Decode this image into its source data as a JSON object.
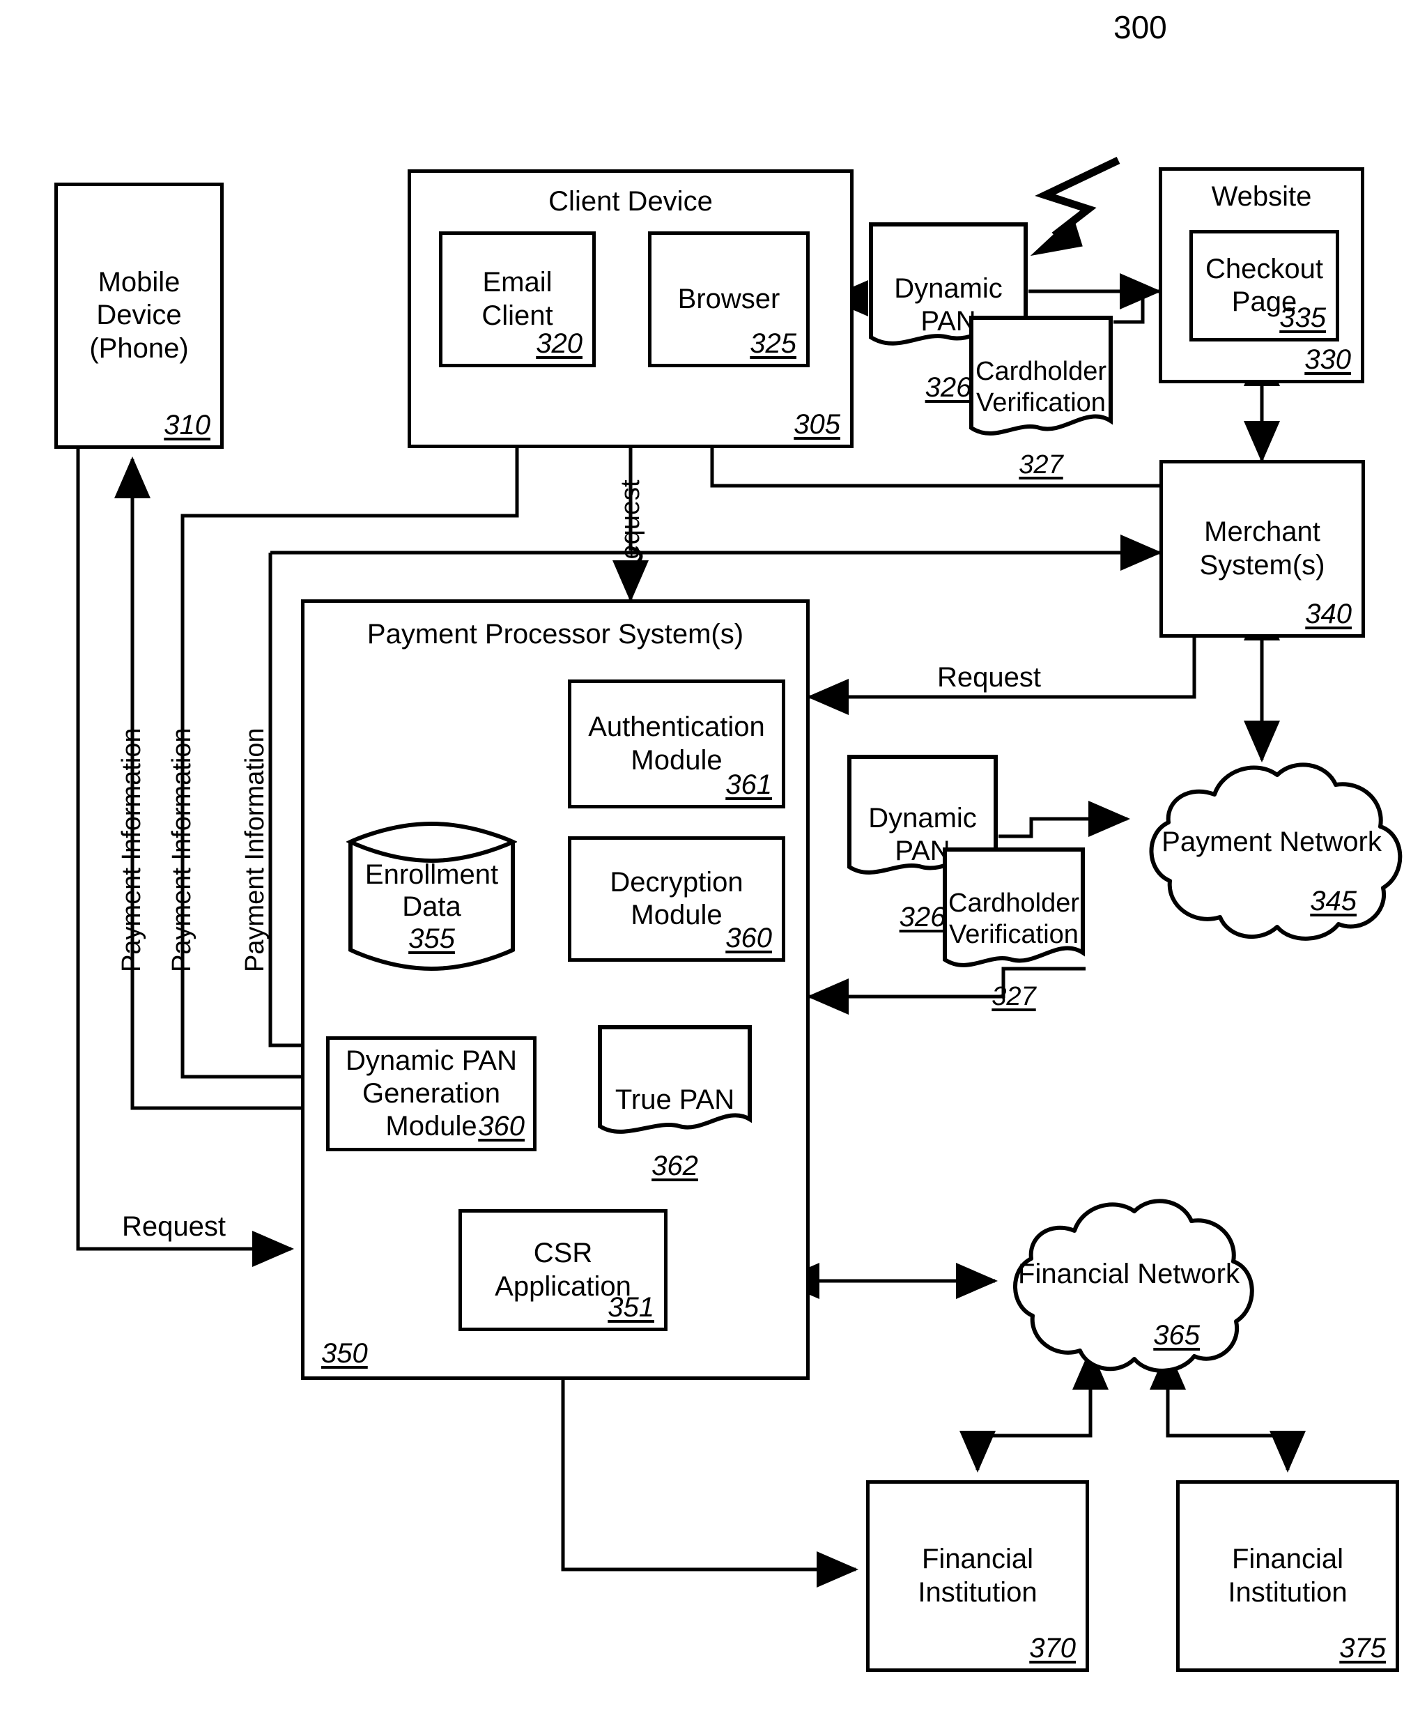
{
  "figure": {
    "number": "300",
    "pointer_icon": "lightning-bolt-pointer"
  },
  "nodes": {
    "mobile_device": {
      "label": "Mobile\nDevice\n(Phone)",
      "ref": "310"
    },
    "client_device": {
      "label": "Client Device",
      "ref": "305"
    },
    "email_client": {
      "label": "Email\nClient",
      "ref": "320"
    },
    "browser": {
      "label": "Browser",
      "ref": "325"
    },
    "website": {
      "label": "Website",
      "ref": "330"
    },
    "checkout_page": {
      "label": "Checkout\nPage",
      "ref": "335"
    },
    "merchant_system": {
      "label": "Merchant\nSystem(s)",
      "ref": "340"
    },
    "payment_processor": {
      "label": "Payment Processor System(s)",
      "ref": "350"
    },
    "authentication_module": {
      "label": "Authentication\nModule",
      "ref": "361"
    },
    "decryption_module": {
      "label": "Decryption\nModule",
      "ref": "360"
    },
    "enrollment_data": {
      "label": "Enrollment\nData",
      "ref": "355"
    },
    "dynamic_pan_generation_module": {
      "label": "Dynamic PAN\nGeneration\nModule",
      "ref": "360"
    },
    "true_pan": {
      "label": "True PAN",
      "ref": "362"
    },
    "csr_application": {
      "label": "CSR\nApplication",
      "ref": "351"
    },
    "payment_network": {
      "label": "Payment Network",
      "ref": "345"
    },
    "financial_network": {
      "label": "Financial Network",
      "ref": "365"
    },
    "financial_institution_370": {
      "label": "Financial\nInstitution",
      "ref": "370"
    },
    "financial_institution_375": {
      "label": "Financial\nInstitution",
      "ref": "375"
    }
  },
  "artifacts": {
    "dynamic_pan_top": {
      "label": "Dynamic\nPAN",
      "ref": "326"
    },
    "cardholder_verification_top": {
      "label": "Cardholder\nVerification",
      "ref": "327"
    },
    "dynamic_pan_mid": {
      "label": "Dynamic\nPAN",
      "ref": "326"
    },
    "cardholder_verification_mid": {
      "label": "Cardholder\nVerification",
      "ref": "327"
    }
  },
  "edge_labels": {
    "request_vertical": "Request",
    "request_merchant": "Request",
    "request_bottom": "Request",
    "payment_information_1": "Payment Information",
    "payment_information_2": "Payment Information",
    "payment_information_3": "Payment Information"
  },
  "colors": {
    "stroke": "#000000",
    "background": "#ffffff"
  }
}
